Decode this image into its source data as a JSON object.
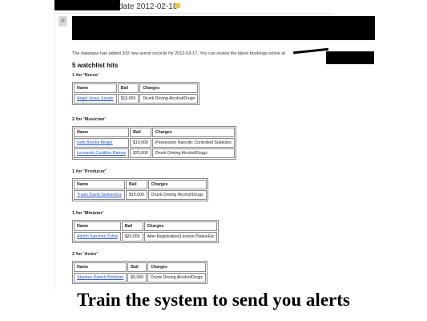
{
  "email": {
    "subject": "date 2012-02-18",
    "intro": "The database has added 302 new arrest records for 2012-02-17. You can review the latest bookings online at",
    "hits_heading": "5 watchlist hits",
    "columns": [
      "Name",
      "Bail",
      "Charges"
    ],
    "groups": [
      {
        "title": "1 for 'Nurse'",
        "rows": [
          {
            "name": "Angel Jesus Jurado",
            "bail": "$15,000",
            "charges": "Drunk Driving Alcohol/Drugs"
          }
        ]
      },
      {
        "title": "2 for 'Musician'",
        "rows": [
          {
            "name": "Seth Brooks Binger",
            "bail": "$10,000",
            "charges": "Possession Narcotic Controlled Substanc"
          },
          {
            "name": "Leonardo Castillon Ramos",
            "bail": "$25,000",
            "charges": "Drunk Driving Alcohol/Drugs"
          }
        ]
      },
      {
        "title": "1 for 'Producer'",
        "rows": [
          {
            "name": "Travis David Senkiewicz",
            "bail": "$15,000",
            "charges": "Drunk Driving Alcohol/Drugs"
          }
        ]
      },
      {
        "title": "1 for 'Minister'",
        "rows": [
          {
            "name": "Adolfo Sanchez Zubia",
            "bail": "$20,000",
            "charges": "Alter Registration/License Plates/Etc"
          }
        ]
      },
      {
        "title": "2 for 'Actor'",
        "rows": [
          {
            "name": "Stephen Patrick Bowman",
            "bail": "$5,000",
            "charges": "Drunk Driving Alcohol/Drugs"
          }
        ]
      }
    ]
  },
  "caption": "Train the system to send you alerts"
}
